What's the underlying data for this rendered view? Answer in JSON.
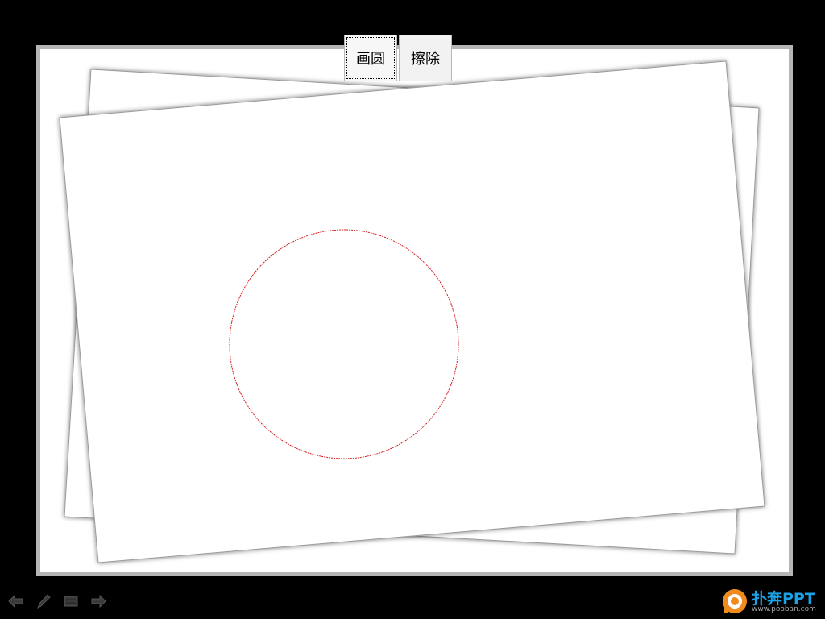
{
  "toolbar": {
    "draw_circle_label": "画圆",
    "erase_label": "擦除"
  },
  "canvas": {
    "circle_color": "#d42020",
    "paper_border_color": "#8a8a8a"
  },
  "nav": {
    "icons": [
      "arrow-left-icon",
      "pen-icon",
      "menu-icon",
      "arrow-right-icon"
    ]
  },
  "branding": {
    "name": "扑奔PPT",
    "url": "www.pooban.com",
    "accent_color": "#1aa2e6",
    "logo_color": "#f08c1e"
  }
}
